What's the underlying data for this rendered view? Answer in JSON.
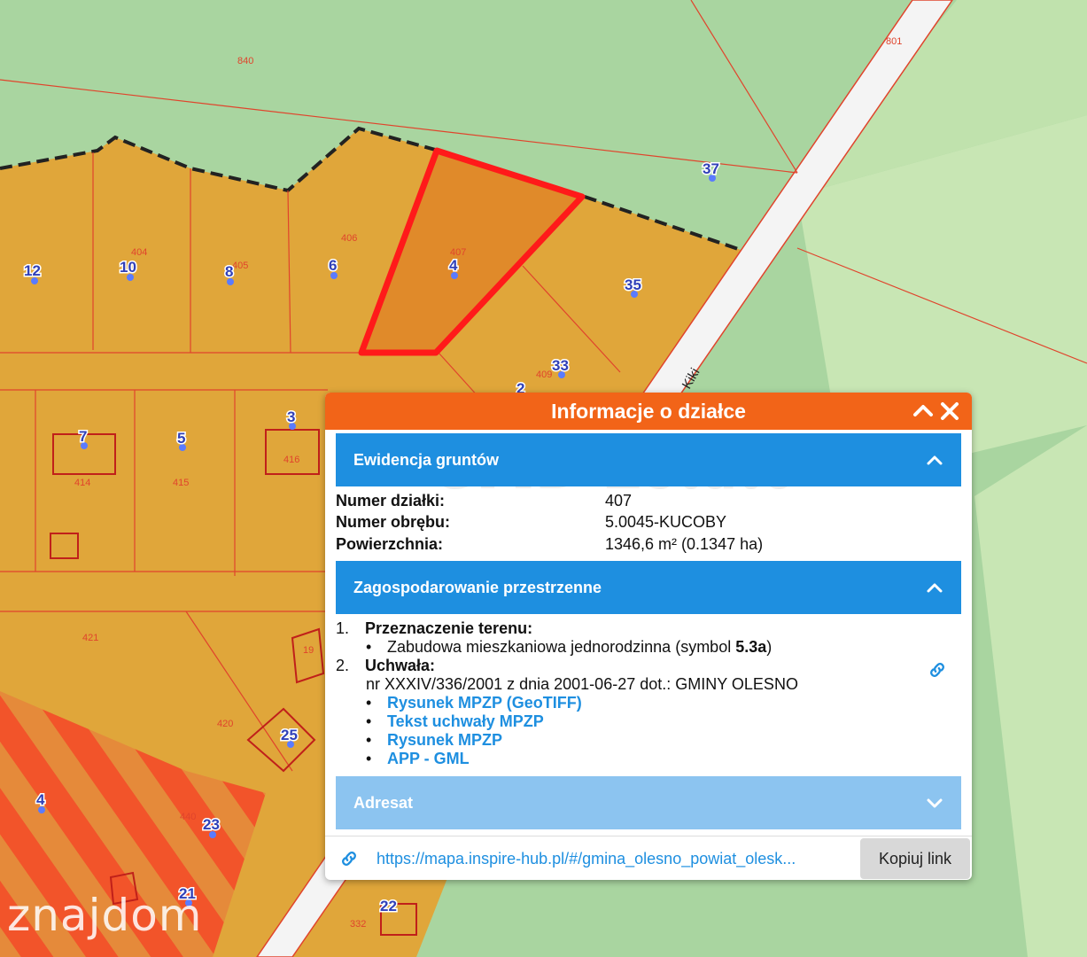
{
  "map": {
    "parcel_labels": [
      "840",
      "801",
      "404",
      "406",
      "405",
      "407",
      "409",
      "414",
      "415",
      "416",
      "421",
      "420",
      "440",
      "332",
      "19"
    ],
    "address_numbers": [
      "37",
      "12",
      "10",
      "8",
      "6",
      "4",
      "35",
      "33",
      "2",
      "7",
      "5",
      "3",
      "25",
      "23",
      "4",
      "21",
      "22"
    ],
    "street_label": "Kiki",
    "highlighted_parcel_color": "#ff1a1a"
  },
  "watermark": "znajdom",
  "popup": {
    "title": "Informacje o działce",
    "watermark": "GMD Estate",
    "ewidencja": {
      "title": "Ewidencja gruntów",
      "rows": [
        {
          "label": "Numer działki:",
          "value": "407"
        },
        {
          "label": "Numer obrębu:",
          "value": "5.0045-KUCOBY"
        },
        {
          "label": "Powierzchnia:",
          "value": "1346,6 m² (0.1347 ha)"
        }
      ]
    },
    "zagospodarowanie": {
      "title": "Zagospodarowanie przestrzenne",
      "item1_num": "1.",
      "item1_label": "Przeznaczenie terenu:",
      "item1_text_before": "Zabudowa mieszkaniowa jednorodzinna (symbol ",
      "item1_symbol": "5.3a",
      "item1_text_after": ")",
      "item2_num": "2.",
      "item2_label": "Uchwała:",
      "item2_text": "nr XXXIV/336/2001 z dnia 2001-06-27 dot.: GMINY OLESNO",
      "links": [
        "Rysunek MPZP (GeoTIFF)",
        "Tekst uchwały MPZP",
        "Rysunek MPZP",
        "APP - GML"
      ]
    },
    "adresat": {
      "title": "Adresat"
    },
    "footer": {
      "url": "https://mapa.inspire-hub.pl/#/gmina_olesno_powiat_olesk...",
      "copy_label": "Kopiuj link"
    }
  }
}
